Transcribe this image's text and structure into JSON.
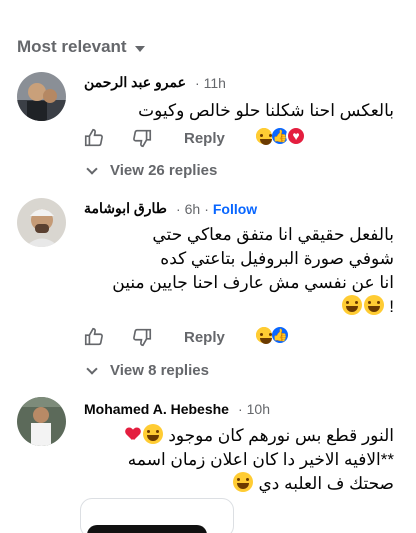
{
  "sort": {
    "label": "Most relevant"
  },
  "comments": [
    {
      "name": "عمرو عبد الرحمن",
      "time": "11h",
      "lines": [
        "بالعكس احنا شكلنا حلو خالص وكيوت"
      ],
      "reply_label": "Reply",
      "view_replies": "View 26 replies",
      "reactions": [
        "haha",
        "like",
        "love"
      ]
    },
    {
      "name": "طارق ابوشامة",
      "time": "6h",
      "follow": "Follow",
      "lines": [
        "بالفعل حقيقي انا متفق معاكي حتي",
        "شوفي صورة البروفيل بتاعتي كده",
        "انا عن نفسي مش عارف احنا جايين منين",
        "!"
      ],
      "reply_label": "Reply",
      "view_replies": "View 8 replies",
      "reactions": [
        "haha",
        "like"
      ]
    },
    {
      "name": "Mohamed A. Hebeshe",
      "time": "10h",
      "lines": [
        "النور قطع بس نورهم كان موجود",
        "**الافيه الاخير دا كان اعلان زمان اسمه",
        "صحتك ف العلبه دي"
      ]
    }
  ],
  "colors": {
    "link": "#0866ff",
    "muted": "#65676b",
    "text": "#050505",
    "like": "#0866ff",
    "love": "#e41e3f",
    "haha": "#ffcc33"
  },
  "icons": [
    "like-icon",
    "dislike-icon",
    "like-reaction-icon",
    "love-reaction-icon",
    "haha-reaction-icon",
    "chevron-down-icon"
  ]
}
